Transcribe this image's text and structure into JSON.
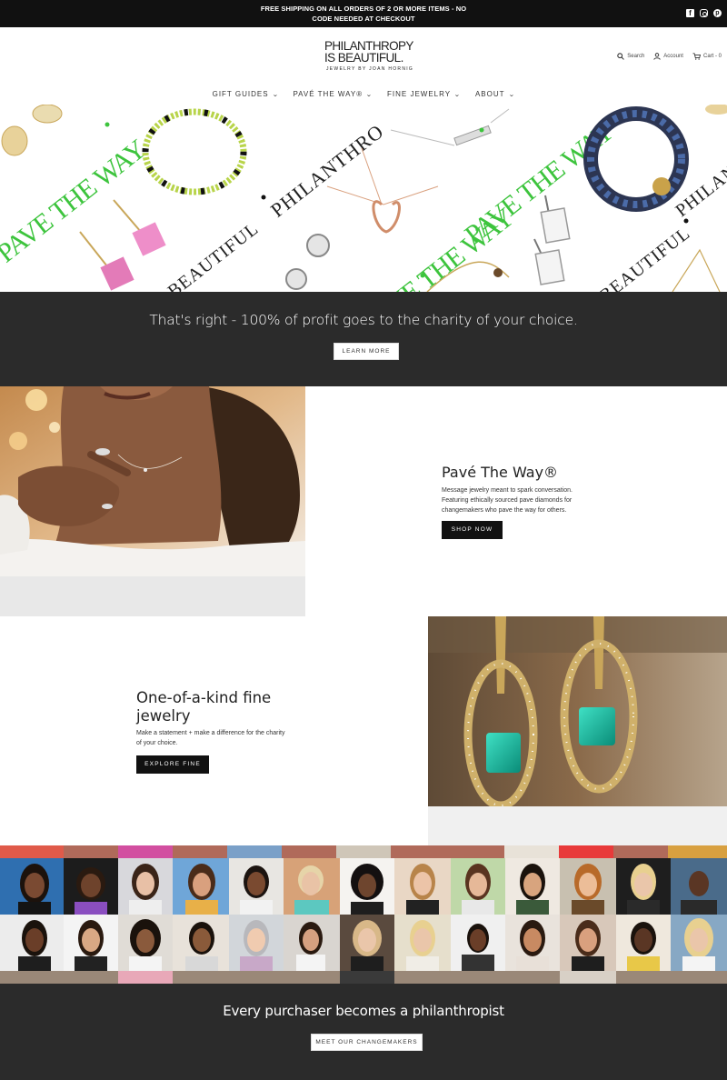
{
  "announcement": {
    "line1": "FREE SHIPPING ON ALL ORDERS OF 2 OR MORE ITEMS - NO",
    "line2": "CODE NEEDED AT CHECKOUT"
  },
  "social": {
    "facebook": "f",
    "pinterest": "p"
  },
  "logo": {
    "line1": "PHILANTHROPY",
    "line2": "IS BEAUTIFUL.",
    "line3": "JEWELRY BY JOAN HORNIG"
  },
  "utility": {
    "search": "Search",
    "account": "Account",
    "cart": "Cart - 0"
  },
  "nav": [
    {
      "label": "GIFT GUIDES"
    },
    {
      "label": "PAVÉ THE WAY®"
    },
    {
      "label": "FINE JEWELRY"
    },
    {
      "label": "ABOUT"
    }
  ],
  "hero": {
    "words": [
      "PAVE THE WAY",
      "PHILANTHRO",
      "PAVE THE WAY",
      "BEAUTIFUL",
      "PAVE THE WAY",
      "BEAUTIFUL",
      "PHILANTH"
    ]
  },
  "charity_band": {
    "tagline": "That's right - 100% of profit goes to the charity of your choice.",
    "button": "LEARN MORE"
  },
  "pave_section": {
    "title": "Pavé The Way®",
    "text1": "Message jewelry meant to spark conversation.",
    "text2": "Featuring ethically sourced pave diamonds for",
    "text3": "changemakers who pave the way for others.",
    "button": "SHOP NOW"
  },
  "fine_section": {
    "title1": "One-of-a-kind fine",
    "title2": "jewelry",
    "text1": "Make a statement + make a difference for the charity",
    "text2": "of your choice.",
    "button": "EXPLORE FINE"
  },
  "changemakers_band": {
    "tagline": "Every purchaser becomes a philanthropist",
    "button": "MEET OUR CHANGEMAKERS"
  },
  "colors": {
    "dark_band": "#2b2b2b",
    "brand_green": "#3dc43d",
    "black": "#111111"
  }
}
